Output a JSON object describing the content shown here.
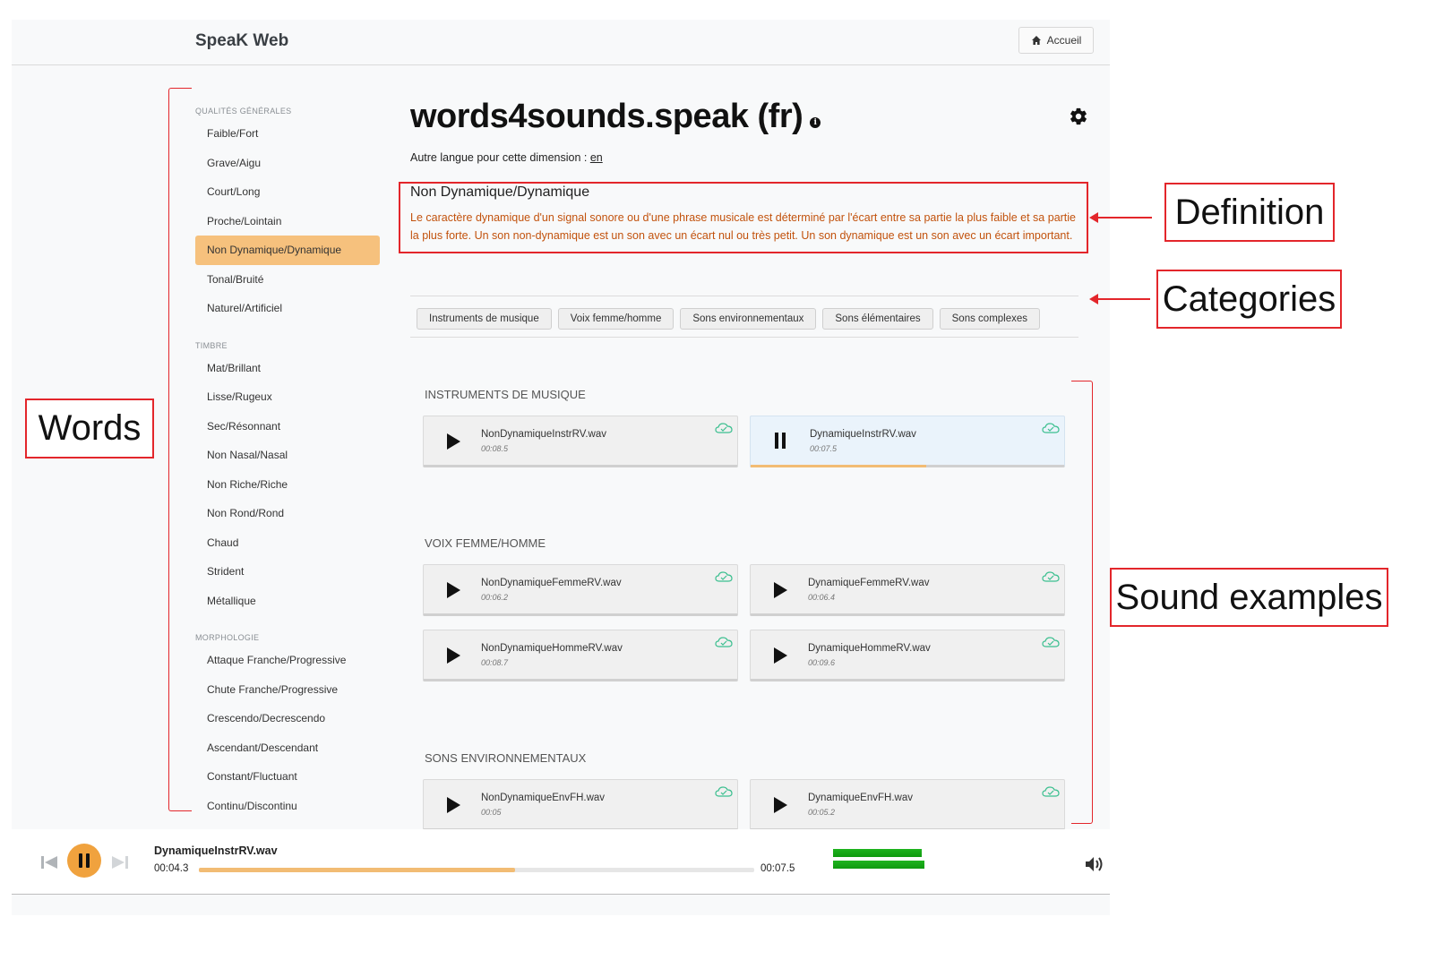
{
  "app": {
    "brand": "SpeaK Web",
    "home_label": "Accueil"
  },
  "sidebar": {
    "groups": [
      {
        "title": "QUALITÉS GÉNÉRALES",
        "items": [
          "Faible/Fort",
          "Grave/Aigu",
          "Court/Long",
          "Proche/Lointain",
          "Non Dynamique/Dynamique",
          "Tonal/Bruité",
          "Naturel/Artificiel"
        ]
      },
      {
        "title": "TIMBRE",
        "items": [
          "Mat/Brillant",
          "Lisse/Rugeux",
          "Sec/Résonnant",
          "Non Nasal/Nasal",
          "Non Riche/Riche",
          "Non Rond/Rond",
          "Chaud",
          "Strident",
          "Métallique"
        ]
      },
      {
        "title": "MORPHOLOGIE",
        "items": [
          "Attaque Franche/Progressive",
          "Chute Franche/Progressive",
          "Crescendo/Decrescendo",
          "Ascendant/Descendant",
          "Constant/Fluctuant",
          "Continu/Discontinu"
        ]
      }
    ],
    "active": "Non Dynamique/Dynamique"
  },
  "main": {
    "title": "words4sounds.speak (fr)",
    "info_icon": "i",
    "alt_lang_prefix": "Autre langue pour cette dimension : ",
    "alt_lang_link": "en",
    "dimension": "Non Dynamique/Dynamique",
    "definition": "Le caractère dynamique d'un signal sonore ou d'une phrase musicale est déterminé par l'écart entre sa partie la plus faible et sa partie la plus forte. Un son non-dynamique est un son avec un écart nul ou très petit. Un son dynamique est un son avec un écart important.",
    "categories": [
      "Instruments de musique",
      "Voix femme/homme",
      "Sons environnementaux",
      "Sons élémentaires",
      "Sons complexes"
    ],
    "sections": [
      {
        "title": "INSTRUMENTS DE MUSIQUE",
        "sounds": [
          {
            "file": "NonDynamiqueInstrRV.wav",
            "duration": "00:08.5",
            "playing": false
          },
          {
            "file": "DynamiqueInstrRV.wav",
            "duration": "00:07.5",
            "playing": true,
            "progress": 0.56
          }
        ]
      },
      {
        "title": "VOIX FEMME/HOMME",
        "sounds": [
          {
            "file": "NonDynamiqueFemmeRV.wav",
            "duration": "00:06.2",
            "playing": false
          },
          {
            "file": "DynamiqueFemmeRV.wav",
            "duration": "00:06.4",
            "playing": false
          },
          {
            "file": "NonDynamiqueHommeRV.wav",
            "duration": "00:08.7",
            "playing": false
          },
          {
            "file": "DynamiqueHommeRV.wav",
            "duration": "00:09.6",
            "playing": false
          }
        ]
      },
      {
        "title": "SONS ENVIRONNEMENTAUX",
        "sounds": [
          {
            "file": "NonDynamiqueEnvFH.wav",
            "duration": "00:05",
            "playing": false
          },
          {
            "file": "DynamiqueEnvFH.wav",
            "duration": "00:05.2",
            "playing": false
          }
        ]
      }
    ]
  },
  "player": {
    "track": "DynamiqueInstrRV.wav",
    "current_time": "00:04.3",
    "total_time": "00:07.5",
    "progress": 0.57,
    "level": [
      0.95,
      0.98
    ]
  },
  "annotations": {
    "definition": "Definition",
    "categories": "Categories",
    "words": "Words",
    "sound_examples": "Sound examples"
  },
  "colors": {
    "accent": "#f0a23e",
    "active_item": "#f6c17d",
    "definition_text": "#c2520d",
    "annotation_red": "#e3262b",
    "meter_green": "#1fb31f"
  }
}
